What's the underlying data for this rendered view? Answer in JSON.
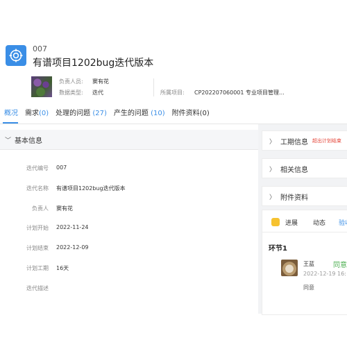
{
  "header": {
    "code": "007",
    "title": "有谱项目1202bug迭代版本",
    "owner_label": "负责人员:",
    "owner_value": "窦有花",
    "type_label": "数据类型:",
    "type_value": "迭代",
    "project_label": "所属项目:",
    "project_value": "CP202207060001 专业项目管理..."
  },
  "tabs": [
    {
      "label": "概况",
      "count": ""
    },
    {
      "label": "需求",
      "count": "(0)"
    },
    {
      "label": "处理的问题",
      "count": "(27)"
    },
    {
      "label": "产生的问题",
      "count": "(10)"
    },
    {
      "label": "附件资料",
      "count": "(0)"
    }
  ],
  "basic": {
    "section_title": "基本信息",
    "fields": [
      {
        "label": "迭代编号",
        "value": "007"
      },
      {
        "label": "迭代名称",
        "value": "有谱项目1202bug迭代版本"
      },
      {
        "label": "负责人",
        "value": "窦有花"
      },
      {
        "label": "计划开始",
        "value": "2022-11-24"
      },
      {
        "label": "计划结束",
        "value": "2022-12-09"
      },
      {
        "label": "计划工期",
        "value": "16天"
      },
      {
        "label": "迭代描述",
        "value": ""
      }
    ]
  },
  "right": {
    "period_title": "工期信息",
    "period_warning": "超出计划结束",
    "related_title": "相关信息",
    "attach_title": "附件资料",
    "subtabs": [
      "进展",
      "动态",
      "验收"
    ],
    "node_title": "环节1",
    "approver_name": "王蓝",
    "approver_status": "同意",
    "approver_time": "2022-12-19 16:",
    "approver_comment": "同意"
  },
  "colors": {
    "accent": "#3a8ee6",
    "warning": "#e5483c",
    "approve": "#4caf50"
  },
  "icons": {
    "app": "target-icon",
    "chevron": "chevron-icon"
  }
}
